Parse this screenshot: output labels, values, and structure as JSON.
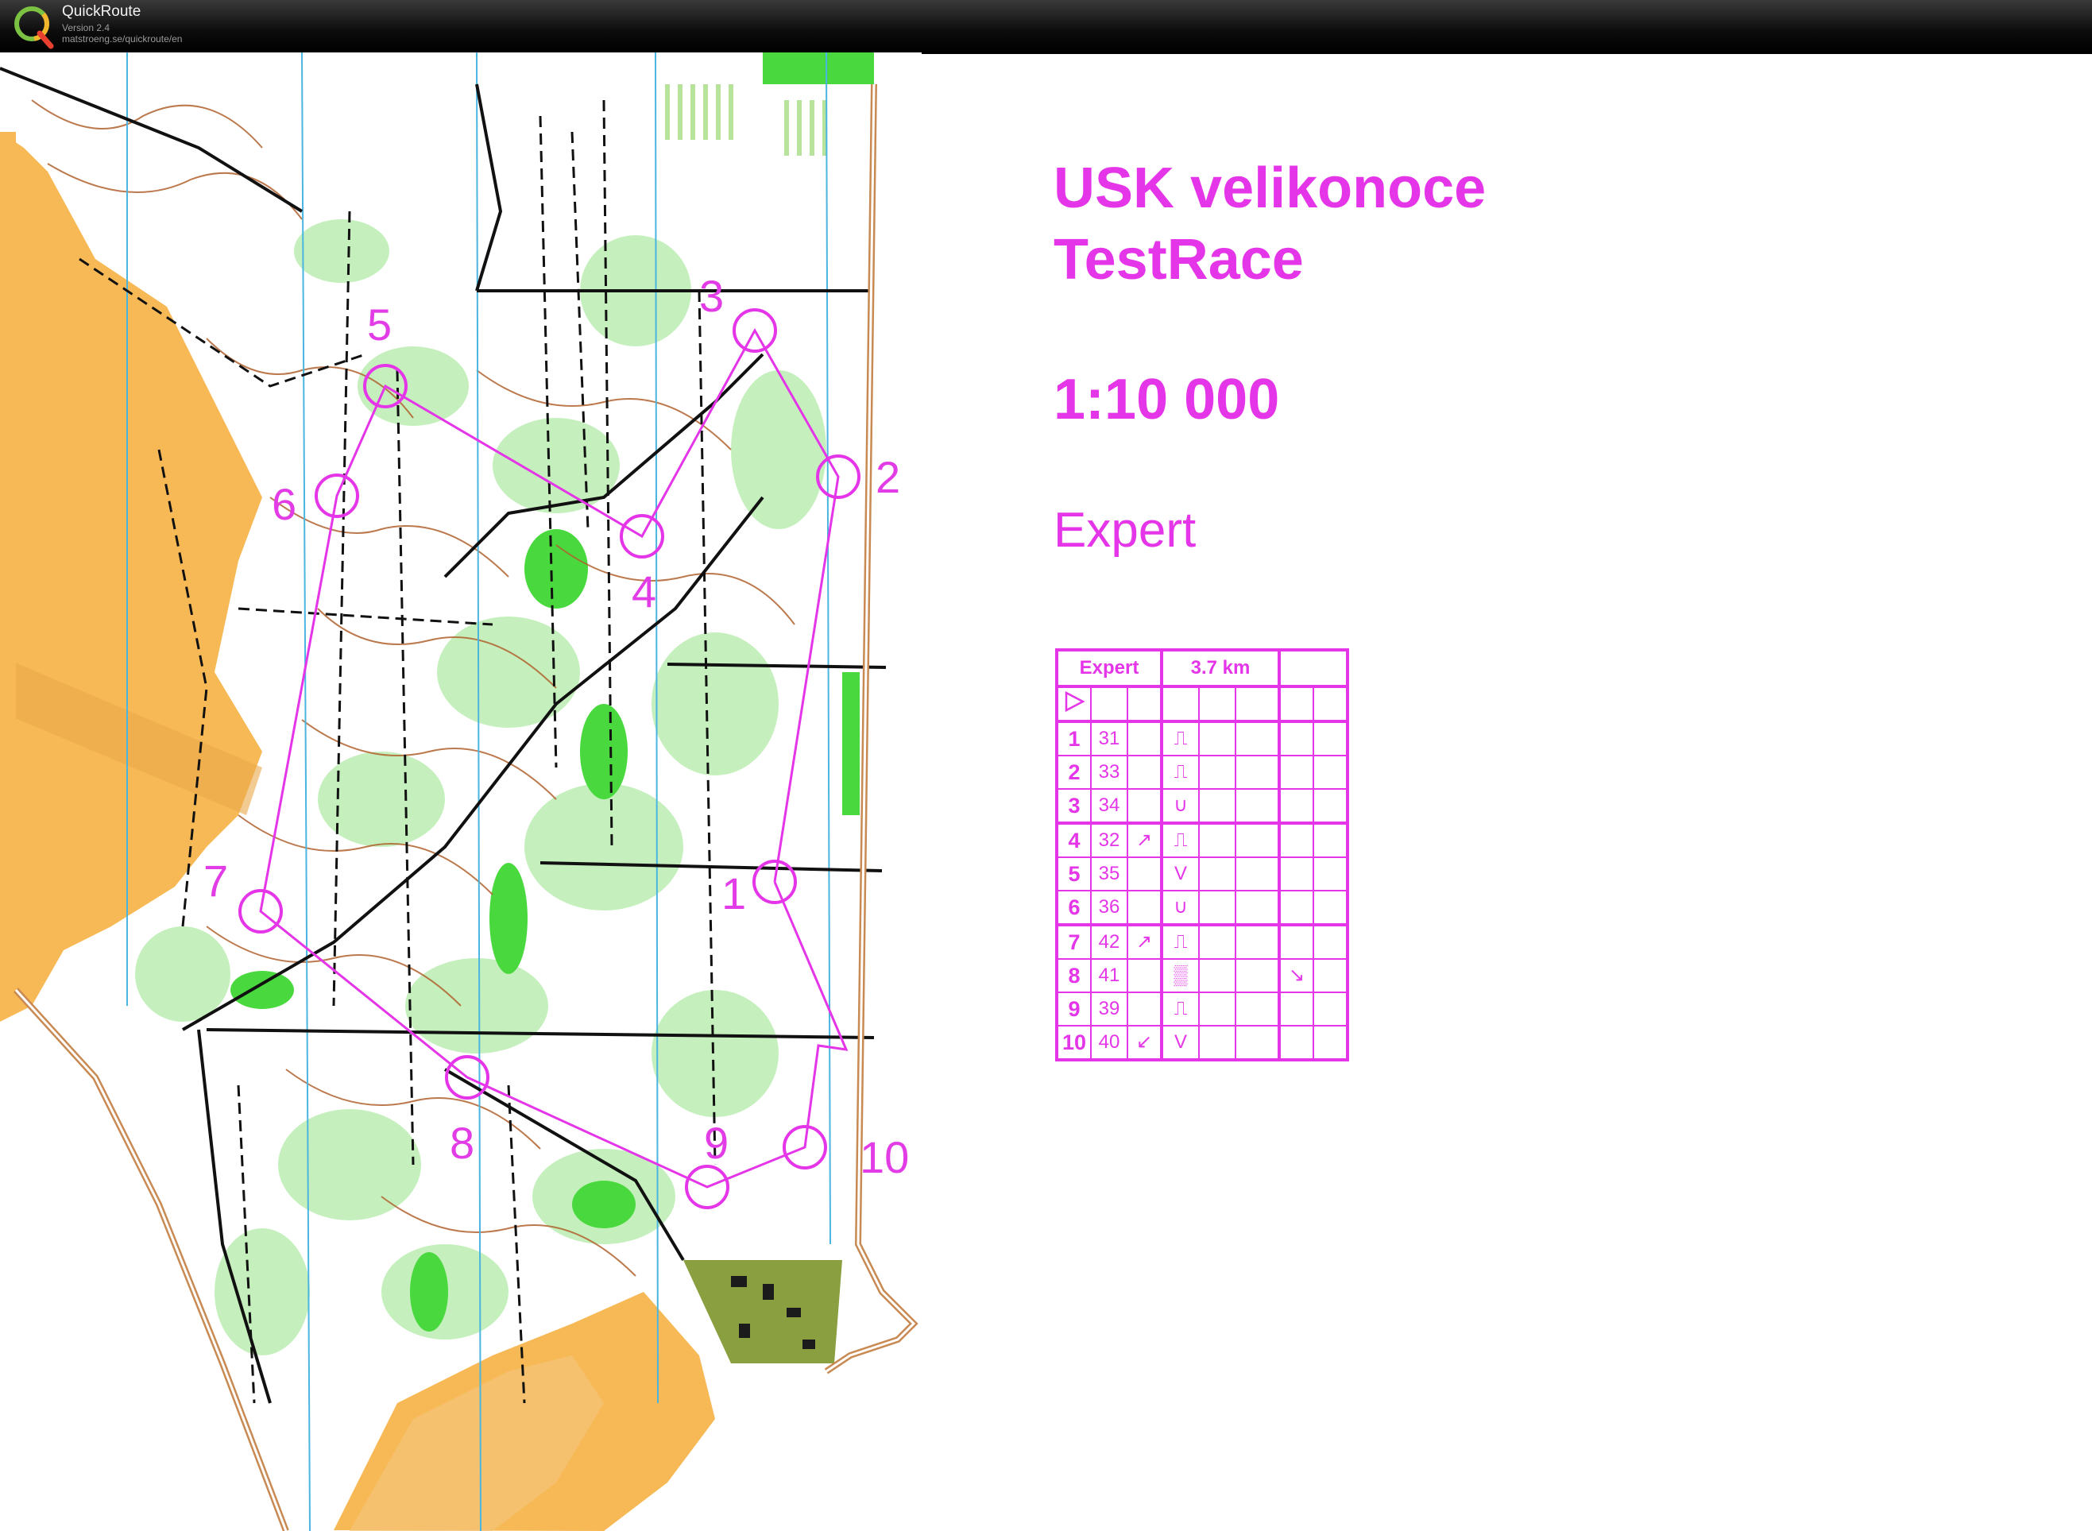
{
  "app": {
    "name": "QuickRoute",
    "version": "Version 2.4",
    "url": "matstroeng.se/quickroute/en"
  },
  "event": {
    "title_line1": "USK velikonoce",
    "title_line2": "TestRace",
    "scale": "1:10 000",
    "course": "Expert"
  },
  "map": {
    "controls": [
      {
        "label": "1"
      },
      {
        "label": "2"
      },
      {
        "label": "3"
      },
      {
        "label": "4"
      },
      {
        "label": "5"
      },
      {
        "label": "6"
      },
      {
        "label": "7"
      },
      {
        "label": "8"
      },
      {
        "label": "9"
      },
      {
        "label": "10"
      }
    ],
    "colors": {
      "course": "#e535e8",
      "open_land": "#f7b955",
      "forest": "#ffffff",
      "green": "#3fd43b",
      "light_green": "#c5f0bd",
      "contour": "#b0622e",
      "water": "#2aa9d9"
    }
  },
  "description_sheet": {
    "header": {
      "course": "Expert",
      "length": "3.7 km"
    },
    "start_symbol": "start-triangle-icon",
    "rows": [
      {
        "num": "1",
        "code": "31",
        "dir": "",
        "feature": "⎍",
        "extra": ""
      },
      {
        "num": "2",
        "code": "33",
        "dir": "",
        "feature": "⎍",
        "extra": ""
      },
      {
        "num": "3",
        "code": "34",
        "dir": "",
        "feature": "∪",
        "extra": ""
      },
      {
        "num": "4",
        "code": "32",
        "dir": "↗",
        "feature": "⎍",
        "extra": ""
      },
      {
        "num": "5",
        "code": "35",
        "dir": "",
        "feature": "V",
        "extra": ""
      },
      {
        "num": "6",
        "code": "36",
        "dir": "",
        "feature": "∪",
        "extra": ""
      },
      {
        "num": "7",
        "code": "42",
        "dir": "↗",
        "feature": "⎍",
        "extra": ""
      },
      {
        "num": "8",
        "code": "41",
        "dir": "",
        "feature": "▒",
        "extra": "↘"
      },
      {
        "num": "9",
        "code": "39",
        "dir": "",
        "feature": "⎍",
        "extra": ""
      },
      {
        "num": "10",
        "code": "40",
        "dir": "↙",
        "feature": "V",
        "extra": ""
      }
    ]
  }
}
